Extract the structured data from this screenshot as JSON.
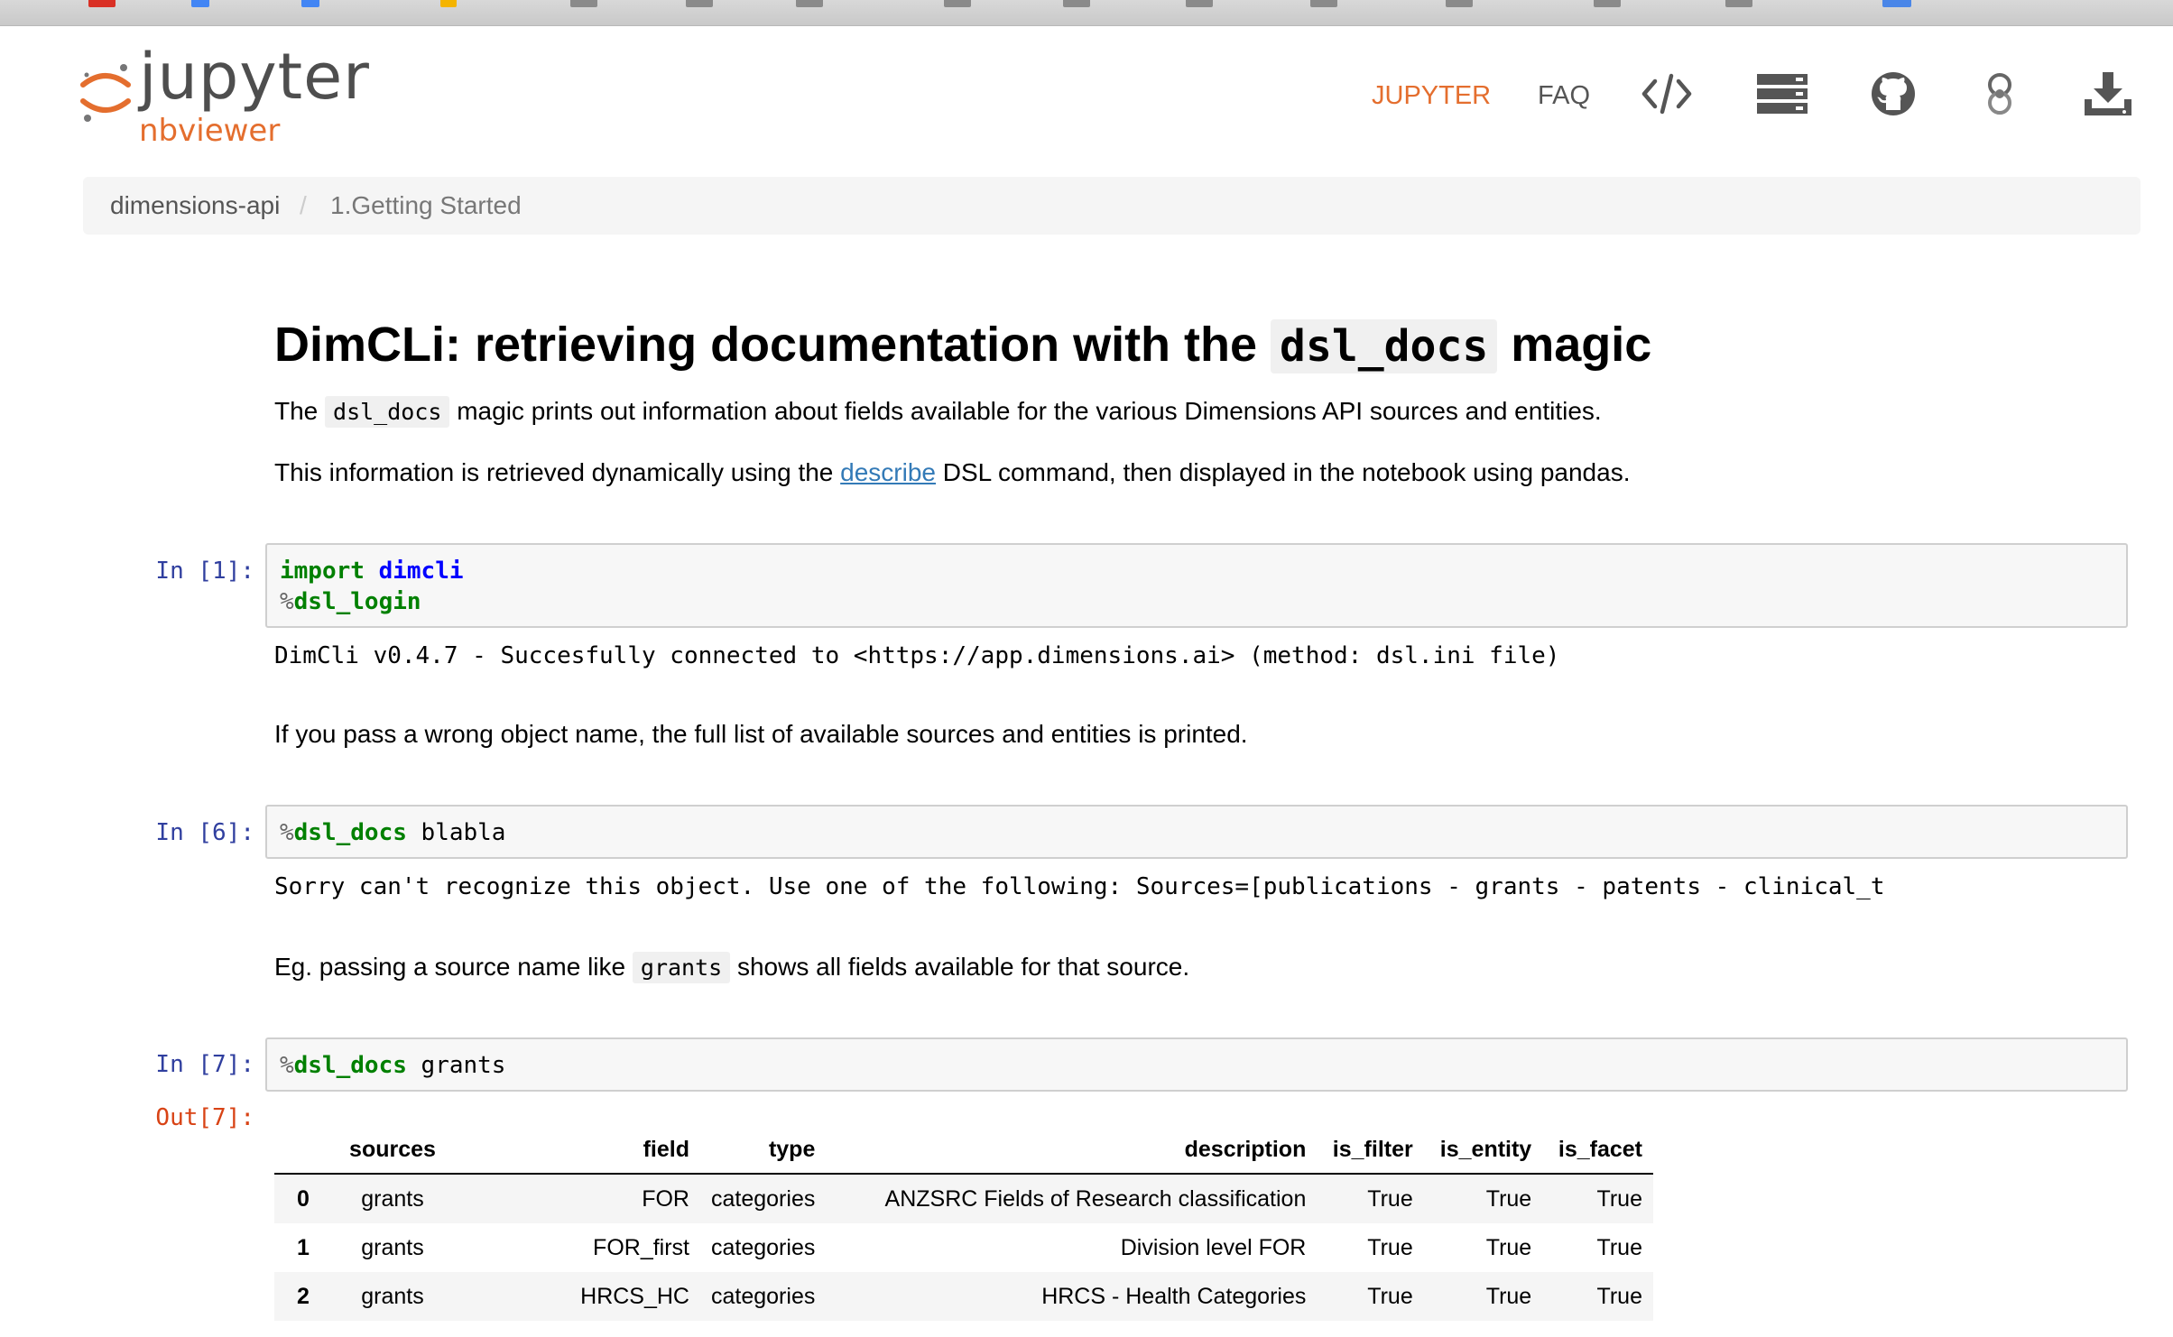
{
  "header": {
    "logo_word": "jupyter",
    "logo_sub": "nbviewer",
    "nav_jupyter": "JUPYTER",
    "nav_faq": "FAQ",
    "icons": [
      "code-icon",
      "server-icon",
      "github-icon",
      "binder-icon",
      "download-icon"
    ],
    "accent_color": "#e46e2e"
  },
  "breadcrumb": [
    "dimensions-api",
    "1.Getting Started"
  ],
  "notebook": {
    "title_before": "DimCLi: retrieving documentation with the ",
    "title_code": "dsl_docs",
    "title_after": " magic",
    "p1_before": "The ",
    "p1_code": "dsl_docs",
    "p1_after": " magic prints out information about fields available for the various Dimensions API sources and entities.",
    "p2_before": "This information is retrieved dynamically using the ",
    "p2_link": "describe",
    "p2_after": " DSL command, then displayed in the notebook using pandas.",
    "cell1_prompt": "In [1]:",
    "cell1_line1_kw": "import",
    "cell1_line1_name": "dimcli",
    "cell1_line2_pct": "%",
    "cell1_line2_magic": "dsl_login",
    "cell1_output": "DimCli v0.4.7 - Succesfully connected to <https://app.dimensions.ai> (method: dsl.ini file)",
    "p3": "If you pass a wrong object name, the full list of available sources and entities is printed.",
    "cell6_prompt": "In [6]:",
    "cell6_pct": "%",
    "cell6_magic": "dsl_docs",
    "cell6_arg": " blabla",
    "cell6_output": "Sorry can't recognize this object. Use one of the following: Sources=[publications - grants - patents - clinical_t",
    "p4_before": "Eg. passing a source name like ",
    "p4_code": "grants",
    "p4_after": " shows all fields available for that source.",
    "cell7_prompt": "In [7]:",
    "cell7_pct": "%",
    "cell7_magic": "dsl_docs",
    "cell7_arg": " grants",
    "cell7_out_prompt": "Out[7]:"
  },
  "table": {
    "columns": [
      "",
      "sources",
      "field",
      "type",
      "description",
      "is_filter",
      "is_entity",
      "is_facet"
    ],
    "rows": [
      [
        "0",
        "grants",
        "FOR",
        "categories",
        "ANZSRC Fields of Research classification",
        "True",
        "True",
        "True"
      ],
      [
        "1",
        "grants",
        "FOR_first",
        "categories",
        "Division level FOR",
        "True",
        "True",
        "True"
      ],
      [
        "2",
        "grants",
        "HRCS_HC",
        "categories",
        "HRCS - Health Categories",
        "True",
        "True",
        "True"
      ]
    ]
  }
}
